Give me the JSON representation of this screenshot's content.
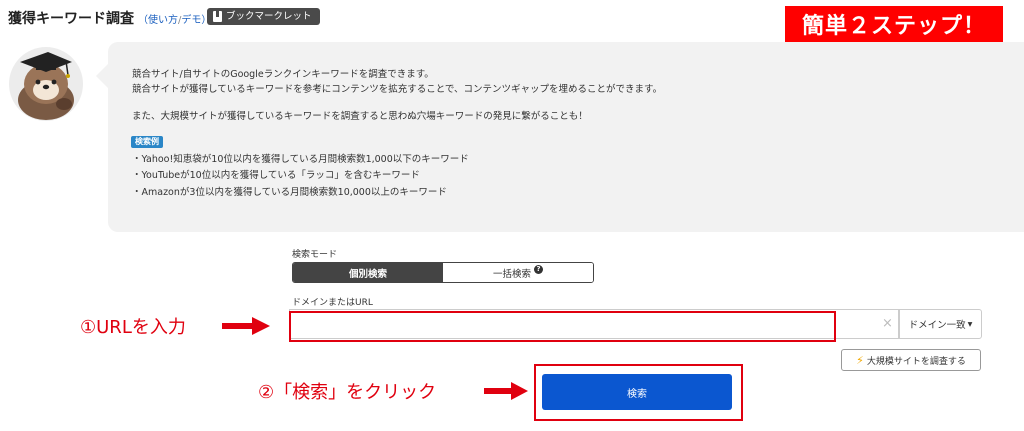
{
  "header": {
    "title": "獲得キーワード調査",
    "usage_open": "（",
    "usage_link": "使い方",
    "usage_sep": "/",
    "demo_link": "デモ",
    "usage_close": "）",
    "bookmarklet_label": "ブックマークレット"
  },
  "banner": {
    "text": "簡単２ステップ！"
  },
  "info": {
    "line1": "競合サイト/自サイトのGoogleランクインキーワードを調査できます。",
    "line2": "競合サイトが獲得しているキーワードを参考にコンテンツを拡充することで、コンテンツギャップを埋めることができます。",
    "line3": "また、大規模サイトが獲得しているキーワードを調査すると思わぬ穴場キーワードの発見に繋がることも！",
    "example_badge": "検索例",
    "examples": [
      "・Yahoo!知恵袋が10位以内を獲得している月間検索数1,000以下のキーワード",
      "・YouTubeが10位以内を獲得している「ラッコ」を含むキーワード",
      "・Amazonが3位以内を獲得している月間検索数10,000以上のキーワード"
    ]
  },
  "search_mode": {
    "label": "検索モード",
    "tabs": [
      {
        "label": "個別検索",
        "active": true
      },
      {
        "label": "一括検索",
        "active": false
      }
    ],
    "help_glyph": "?"
  },
  "domain": {
    "label": "ドメインまたはURL",
    "value": "",
    "placeholder": "",
    "clear_glyph": "×",
    "match_option": "ドメイン一致",
    "match_caret": "▾"
  },
  "large_site_button": {
    "label": "大規模サイトを調査する",
    "icon_glyph": "⚡"
  },
  "search_button": {
    "label": "検索"
  },
  "annotations": {
    "step1": "①URLを入力",
    "step2": "②「検索」をクリック"
  },
  "icons": {
    "bookmarklet": "bookmark-icon",
    "mascot": "sea-otter-graduate-avatar",
    "bolt": "bolt-icon",
    "clear": "close-icon"
  },
  "colors": {
    "accent_blue": "#0b57d0",
    "annotation_red": "#e0000f",
    "banner_red": "#ff0000",
    "badge_blue": "#2a86c7",
    "panel_gray": "#f2f2f2"
  }
}
